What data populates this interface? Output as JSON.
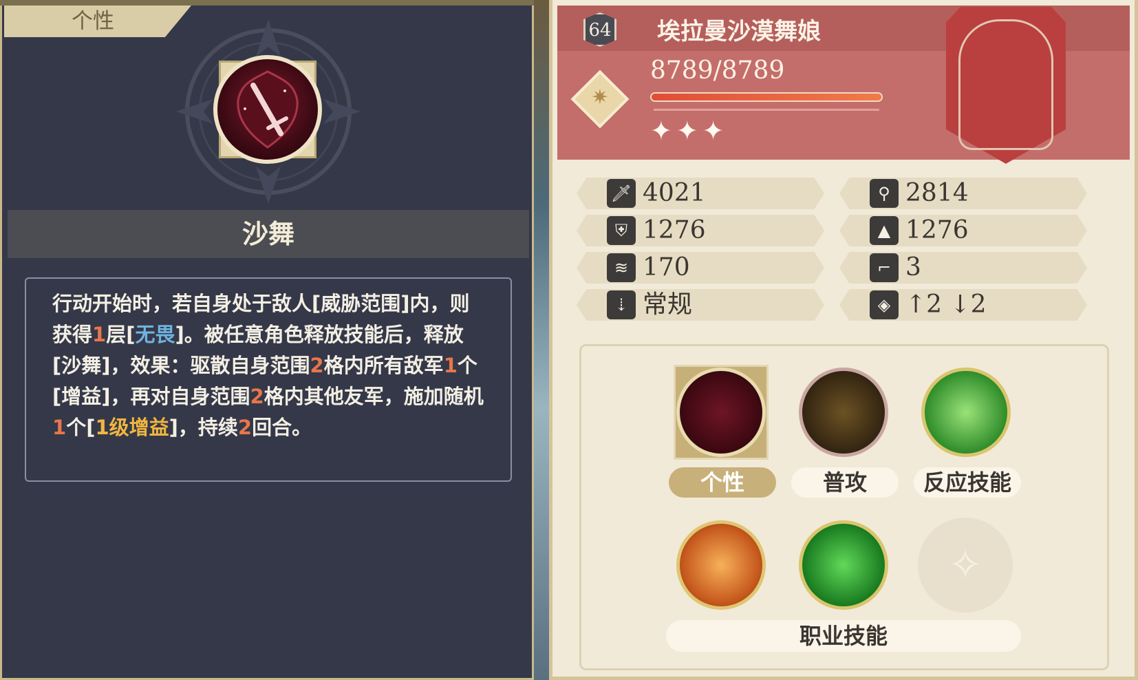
{
  "left": {
    "tab_label": "个性",
    "skill_name": "沙舞",
    "skill_icon": "sword-shield-icon",
    "description": [
      {
        "t": "行动开始时，若自身处于敌人[威胁范围]内，则获得",
        "c": ""
      },
      {
        "t": "1",
        "c": "num"
      },
      {
        "t": "层[",
        "c": ""
      },
      {
        "t": "无畏",
        "c": "blue"
      },
      {
        "t": "]。被任意角色释放技能后，释放[沙舞]，效果：驱散自身范围",
        "c": ""
      },
      {
        "t": "2",
        "c": "num"
      },
      {
        "t": "格内所有敌军",
        "c": ""
      },
      {
        "t": "1",
        "c": "num"
      },
      {
        "t": "个[增益]，再对自身范围",
        "c": ""
      },
      {
        "t": "2",
        "c": "num"
      },
      {
        "t": "格内其他友军，施加随机",
        "c": ""
      },
      {
        "t": "1",
        "c": "num"
      },
      {
        "t": "个[",
        "c": ""
      },
      {
        "t": "1级增益",
        "c": "gold"
      },
      {
        "t": "]，持续",
        "c": ""
      },
      {
        "t": "2",
        "c": "num"
      },
      {
        "t": "回合。",
        "c": ""
      }
    ]
  },
  "right": {
    "level": "64",
    "name": "埃拉曼沙漠舞娘",
    "hp_text": "8789/8789",
    "hp_fraction": 1.0,
    "stars": "✦✦✦",
    "class_icon": "compass-icon",
    "crest_icon": "scales-crest-icon",
    "stats": [
      {
        "icon": "sword-icon",
        "glyph": "🗡",
        "value": "4021"
      },
      {
        "icon": "staff-icon",
        "glyph": "⚲",
        "value": "2814"
      },
      {
        "icon": "shield-icon",
        "glyph": "⛨",
        "value": "1276"
      },
      {
        "icon": "wizard-hat-icon",
        "glyph": "▲",
        "value": "1276"
      },
      {
        "icon": "wing-icon",
        "glyph": "≋",
        "value": "170"
      },
      {
        "icon": "boot-icon",
        "glyph": "⌐",
        "value": "3"
      },
      {
        "icon": "unit-type-icon",
        "glyph": "⇣",
        "value": "常规"
      },
      {
        "icon": "terrain-icon",
        "glyph": "◈",
        "value": "↑2 ↓2"
      }
    ],
    "skills": [
      {
        "label": "个性",
        "icon": "sword-shield-icon",
        "active": true
      },
      {
        "label": "普攻",
        "icon": "golden-sword-icon",
        "active": false
      },
      {
        "label": "反应技能",
        "icon": "counter-attack-icon",
        "active": false
      }
    ],
    "class_skills_label": "职业技能",
    "class_skills": [
      {
        "icon": "anvil-icon"
      },
      {
        "icon": "heal-cross-icon"
      },
      {
        "icon": "empty-slot-icon"
      }
    ]
  }
}
